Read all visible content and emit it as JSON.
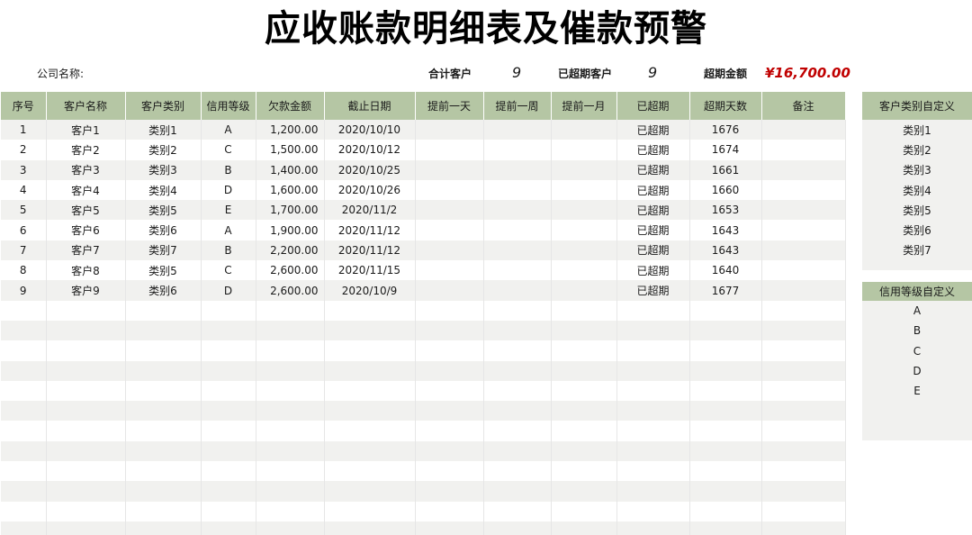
{
  "title": "应收账款明细表及催款预警",
  "info": {
    "company_label": "公司名称:",
    "company_value": "",
    "total_customers_label": "合计客户",
    "total_customers_value": "9",
    "overdue_customers_label": "已超期客户",
    "overdue_customers_value": "9",
    "overdue_amount_label": "超期金额",
    "overdue_amount_value": "¥16,700.00"
  },
  "table": {
    "headers": [
      "序号",
      "客户名称",
      "客户类别",
      "信用等级",
      "欠款金额",
      "截止日期",
      "提前一天",
      "提前一周",
      "提前一月",
      "已超期",
      "超期天数",
      "备注"
    ],
    "rows": [
      [
        "1",
        "客户1",
        "类别1",
        "A",
        "1,200.00",
        "2020/10/10",
        "",
        "",
        "",
        "已超期",
        "1676",
        ""
      ],
      [
        "2",
        "客户2",
        "类别2",
        "C",
        "1,500.00",
        "2020/10/12",
        "",
        "",
        "",
        "已超期",
        "1674",
        ""
      ],
      [
        "3",
        "客户3",
        "类别3",
        "B",
        "1,400.00",
        "2020/10/25",
        "",
        "",
        "",
        "已超期",
        "1661",
        ""
      ],
      [
        "4",
        "客户4",
        "类别4",
        "D",
        "1,600.00",
        "2020/10/26",
        "",
        "",
        "",
        "已超期",
        "1660",
        ""
      ],
      [
        "5",
        "客户5",
        "类别5",
        "E",
        "1,700.00",
        "2020/11/2",
        "",
        "",
        "",
        "已超期",
        "1653",
        ""
      ],
      [
        "6",
        "客户6",
        "类别6",
        "A",
        "1,900.00",
        "2020/11/12",
        "",
        "",
        "",
        "已超期",
        "1643",
        ""
      ],
      [
        "7",
        "客户7",
        "类别7",
        "B",
        "2,200.00",
        "2020/11/12",
        "",
        "",
        "",
        "已超期",
        "1643",
        ""
      ],
      [
        "8",
        "客户8",
        "类别5",
        "C",
        "2,600.00",
        "2020/11/15",
        "",
        "",
        "",
        "已超期",
        "1640",
        ""
      ],
      [
        "9",
        "客户9",
        "类别6",
        "D",
        "2,600.00",
        "2020/10/9",
        "",
        "",
        "",
        "已超期",
        "1677",
        ""
      ]
    ]
  },
  "category_table": {
    "header": "客户类别自定义",
    "items": [
      "类别1",
      "类别2",
      "类别3",
      "类别4",
      "类别5",
      "类别6",
      "类别7"
    ]
  },
  "credit_table": {
    "header": "信用等级自定义",
    "items": [
      "A",
      "B",
      "C",
      "D",
      "E"
    ]
  },
  "colors": {
    "header_bg": "#b5c6a4",
    "row_stripe": "#f1f1ef",
    "amount_red": "#c00000"
  }
}
